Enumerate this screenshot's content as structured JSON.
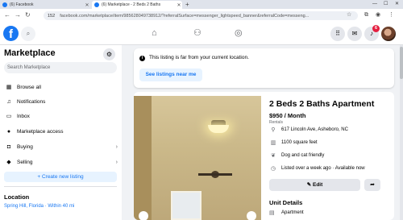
{
  "browser": {
    "tabs": [
      {
        "label": "(6) Facebook"
      },
      {
        "label": "(6) Marketplace - 2 Beds 2 Baths"
      }
    ],
    "new_tab": "+",
    "window_controls": {
      "minimize": "—",
      "maximize": "☐",
      "close": "✕"
    },
    "address": {
      "site_info": "152",
      "url": "facebook.com/marketplace/item/985628049738912/?referralSurface=messenger_lightspeed_banner&referralCode=messeng..."
    }
  },
  "fb": {
    "logo": "f",
    "notifications_badge": "6"
  },
  "sidebar": {
    "title": "Marketplace",
    "search_placeholder": "Search Marketplace",
    "items": [
      {
        "label": "Browse all",
        "icon": "storefront-icon"
      },
      {
        "label": "Notifications",
        "icon": "bell-icon"
      },
      {
        "label": "Inbox",
        "icon": "inbox-icon"
      },
      {
        "label": "Marketplace access",
        "icon": "user-icon"
      },
      {
        "label": "Buying",
        "icon": "bag-icon"
      },
      {
        "label": "Selling",
        "icon": "tag-icon"
      }
    ],
    "create_listing": "+ Create new listing",
    "location_heading": "Location",
    "location_value": "Spring Hill, Florida · Within 40 mi"
  },
  "notice": {
    "message": "This listing is far from your current location.",
    "button": "See listings near me"
  },
  "listing": {
    "title": "2 Beds 2 Baths Apartment",
    "price": "$950 / Month",
    "category": "Rentals",
    "address": "617 Lincoln Ave, Asheboro, NC",
    "size": "1100 square feet",
    "pets": "Dog and cat friendly",
    "listed": "Listed over a week ago · Available now",
    "edit_label": "Edit",
    "unit_details_heading": "Unit Details",
    "unit_type": "Apartment"
  }
}
